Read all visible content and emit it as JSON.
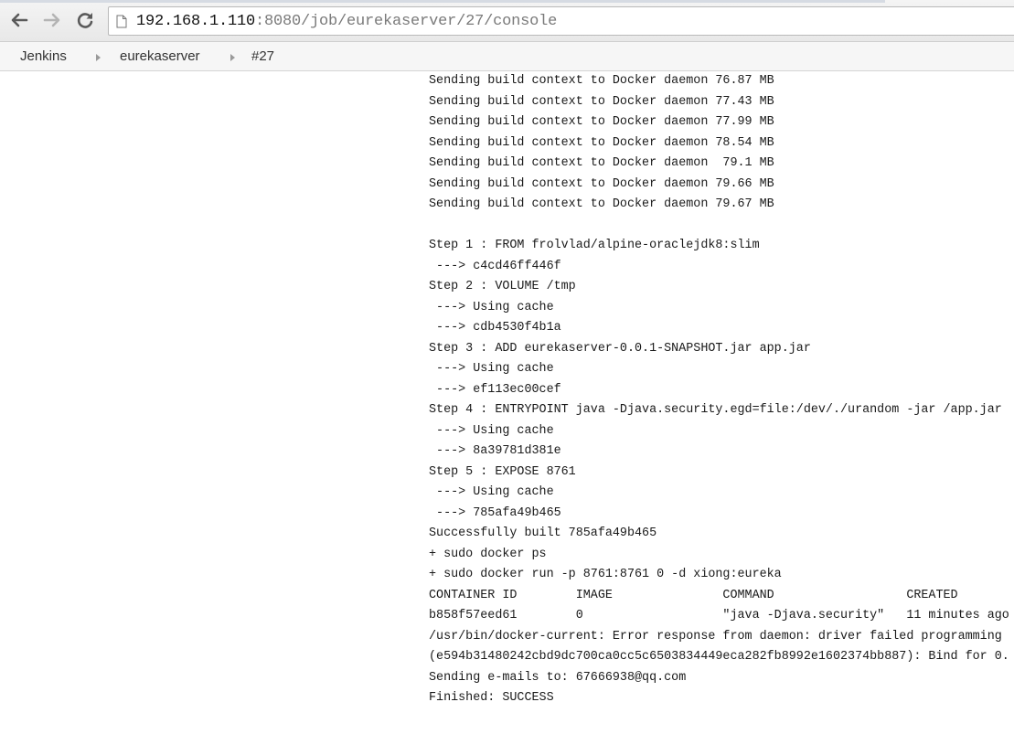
{
  "browser": {
    "url_host": "192.168.1.110",
    "url_rest": ":8080/job/eurekaserver/27/console"
  },
  "breadcrumb": {
    "items": [
      "Jenkins",
      "eurekaserver",
      "#27"
    ]
  },
  "console": {
    "lines": [
      "Sending build context to Docker daemon 76.87 MB",
      "Sending build context to Docker daemon 77.43 MB",
      "Sending build context to Docker daemon 77.99 MB",
      "Sending build context to Docker daemon 78.54 MB",
      "Sending build context to Docker daemon  79.1 MB",
      "Sending build context to Docker daemon 79.66 MB",
      "Sending build context to Docker daemon 79.67 MB",
      "",
      "Step 1 : FROM frolvlad/alpine-oraclejdk8:slim",
      " ---> c4cd46ff446f",
      "Step 2 : VOLUME /tmp",
      " ---> Using cache",
      " ---> cdb4530f4b1a",
      "Step 3 : ADD eurekaserver-0.0.1-SNAPSHOT.jar app.jar",
      " ---> Using cache",
      " ---> ef113ec00cef",
      "Step 4 : ENTRYPOINT java -Djava.security.egd=file:/dev/./urandom -jar /app.jar",
      " ---> Using cache",
      " ---> 8a39781d381e",
      "Step 5 : EXPOSE 8761",
      " ---> Using cache",
      " ---> 785afa49b465",
      "Successfully built 785afa49b465",
      "+ sudo docker ps",
      "+ sudo docker run -p 8761:8761 0 -d xiong:eureka",
      "CONTAINER ID        IMAGE               COMMAND                  CREATED",
      "b858f57eed61        0                   \"java -Djava.security\"   11 minutes ago",
      "/usr/bin/docker-current: Error response from daemon: driver failed programming",
      "(e594b31480242cbd9dc700ca0cc5c6503834449eca282fb8992e1602374bb887): Bind for 0.",
      "Sending e-mails to: 67666938@qq.com",
      "Finished: SUCCESS"
    ]
  }
}
